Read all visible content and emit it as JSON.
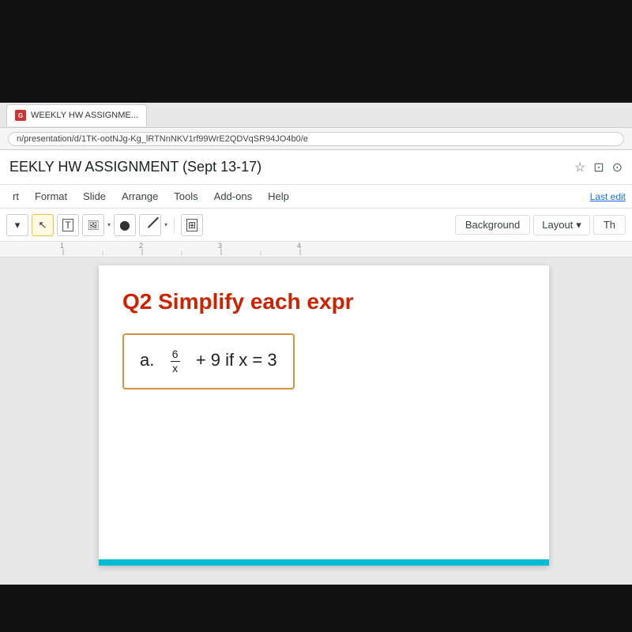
{
  "top_bar": {
    "height": "top dark bar"
  },
  "tab": {
    "label": "WEEKLY HW ASSIGNME...",
    "icon": "G"
  },
  "address": {
    "url": "n/presentation/d/1TK-ootNJg-Kg_lRTNnNKV1rf99WrE2QDVqSR94JO4b0/e"
  },
  "title_bar": {
    "title": "EEKLY HW ASSIGNMENT (Sept 13-17)",
    "star_icon": "☆",
    "present_icon": "⊡",
    "cloud_icon": "⊙"
  },
  "menu": {
    "items": [
      "rt",
      "Format",
      "Slide",
      "Arrange",
      "Tools",
      "Add-ons",
      "Help"
    ],
    "last_edit": "Last edit"
  },
  "toolbar": {
    "background_btn": "Background",
    "layout_btn": "Layout",
    "theme_btn": "Th"
  },
  "slide": {
    "question_label": "Q2  Simplify each expr",
    "math_expression": "a.",
    "fraction_numerator": "6",
    "fraction_denominator": "x",
    "expression_suffix": "+ 9 if x = 3",
    "accent_color": "#00bcd4"
  },
  "ruler": {
    "marks": [
      "1",
      "2",
      "3",
      "4"
    ]
  }
}
